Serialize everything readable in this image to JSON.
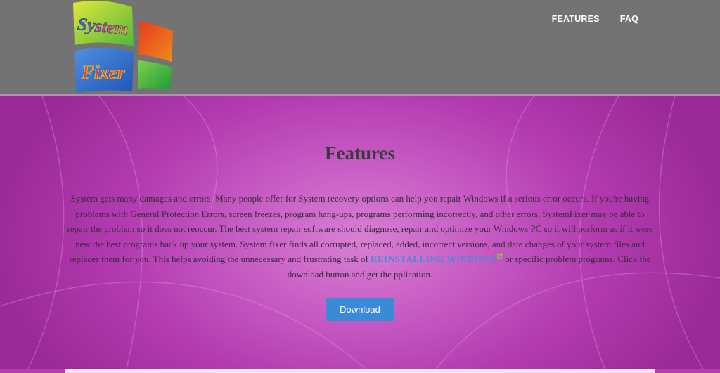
{
  "logo": {
    "word1": "System",
    "word2": "Fixer"
  },
  "nav": {
    "features": "FEATURES",
    "faq": "FAQ"
  },
  "hero": {
    "title": "Features",
    "paragraph_part1": "System gets many damages and errors. Many people offer for System recovery options can help you repair Windows if a serious error occurs. If you're having problems with General Protection Errors, screen freezes, program hang-ups, programs performing incorrectly, and other errors, SystemFixer may be able to repair the problem so it does not reoccur. The best system repair software should diagnose, repair and optimize your Windows PC so it will perform as if it were new the best programs back up your system. System fixer finds all corrupted, replaced, added, incorrect versions, and date changes of your system files and replaces them for you. This helps avoiding the unnecessary and frustrating task of ",
    "link_text": "REINSTALLING WINDOWS",
    "paragraph_part2": " or specific problem programs. Click the download button and get the pplication.",
    "download_label": "Download"
  },
  "colors": {
    "header_bg": "#737373",
    "hero_purple": "#b23bb0",
    "button_blue": "#3b8ad8",
    "link_blue": "#4f87d8"
  }
}
